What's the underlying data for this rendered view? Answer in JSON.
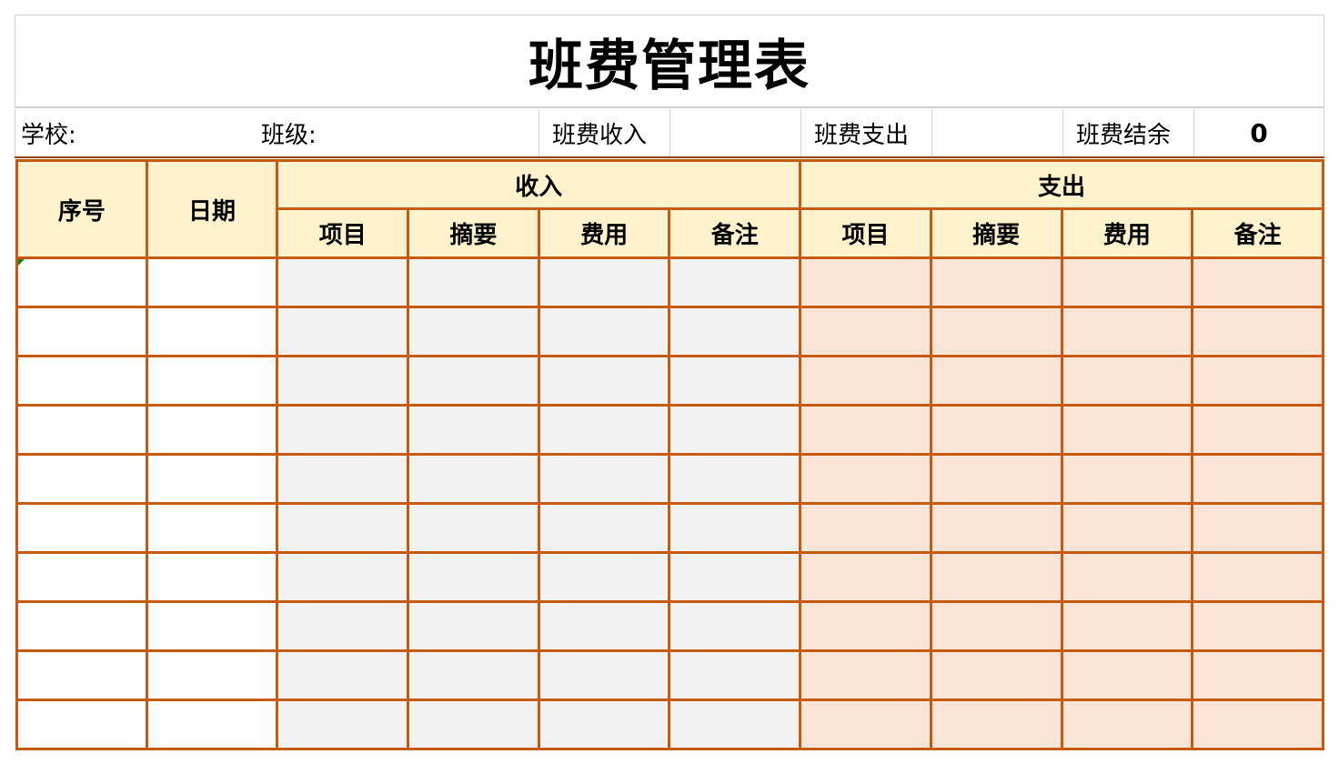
{
  "sheet": {
    "title": "班费管理表",
    "info": {
      "school_label": "学校:",
      "class_label": "班级:",
      "income_label": "班费收入",
      "income_value": "",
      "expense_label": "班费支出",
      "expense_value": "",
      "balance_label": "班费结余",
      "balance_value": "0"
    },
    "table": {
      "headers": {
        "index": "序号",
        "date": "日期",
        "income_group": "收入",
        "expense_group": "支出",
        "income_cols": [
          "项目",
          "摘要",
          "费用",
          "备注"
        ],
        "expense_cols": [
          "项目",
          "摘要",
          "费用",
          "备注"
        ]
      },
      "rows": [
        {
          "index": "",
          "date": "",
          "income": [
            "",
            "",
            "",
            ""
          ],
          "expense": [
            "",
            "",
            "",
            ""
          ]
        },
        {
          "index": "",
          "date": "",
          "income": [
            "",
            "",
            "",
            ""
          ],
          "expense": [
            "",
            "",
            "",
            ""
          ]
        },
        {
          "index": "",
          "date": "",
          "income": [
            "",
            "",
            "",
            ""
          ],
          "expense": [
            "",
            "",
            "",
            ""
          ]
        },
        {
          "index": "",
          "date": "",
          "income": [
            "",
            "",
            "",
            ""
          ],
          "expense": [
            "",
            "",
            "",
            ""
          ]
        },
        {
          "index": "",
          "date": "",
          "income": [
            "",
            "",
            "",
            ""
          ],
          "expense": [
            "",
            "",
            "",
            ""
          ]
        },
        {
          "index": "",
          "date": "",
          "income": [
            "",
            "",
            "",
            ""
          ],
          "expense": [
            "",
            "",
            "",
            ""
          ]
        },
        {
          "index": "",
          "date": "",
          "income": [
            "",
            "",
            "",
            ""
          ],
          "expense": [
            "",
            "",
            "",
            ""
          ]
        },
        {
          "index": "",
          "date": "",
          "income": [
            "",
            "",
            "",
            ""
          ],
          "expense": [
            "",
            "",
            "",
            ""
          ]
        },
        {
          "index": "",
          "date": "",
          "income": [
            "",
            "",
            "",
            ""
          ],
          "expense": [
            "",
            "",
            "",
            ""
          ]
        },
        {
          "index": "",
          "date": "",
          "income": [
            "",
            "",
            "",
            ""
          ],
          "expense": [
            "",
            "",
            "",
            ""
          ]
        }
      ]
    },
    "colors": {
      "grid_border": "#c55a11",
      "header_fill": "#fff2cc",
      "income_fill": "#f2f2f2",
      "expense_fill": "#fce4d6"
    }
  }
}
